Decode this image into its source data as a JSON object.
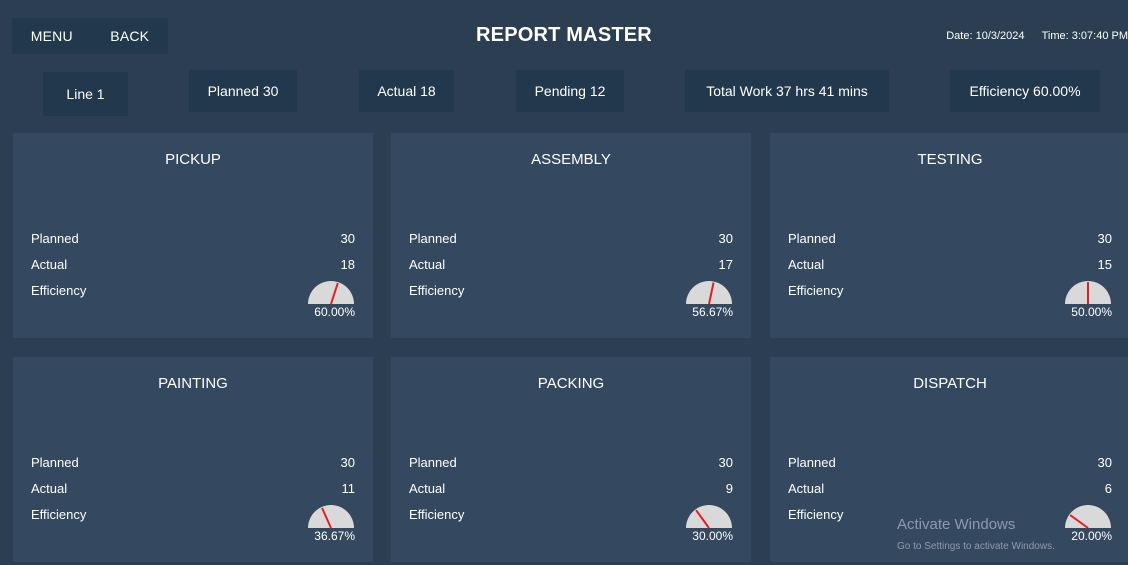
{
  "nav": {
    "menu_label": "MENU",
    "back_label": "BACK"
  },
  "header": {
    "title": "REPORT MASTER",
    "date": "Date: 10/3/2024",
    "time": "Time: 3:07:40 PM"
  },
  "summary": {
    "line": "Line 1",
    "planned": "Planned 30",
    "actual": "Actual 18",
    "pending": "Pending 12",
    "total_work": "Total Work 37 hrs 41 mins",
    "efficiency": "Efficiency 60.00%"
  },
  "labels": {
    "planned": "Planned",
    "actual": "Actual",
    "efficiency": "Efficiency"
  },
  "stations": [
    {
      "name": "PICKUP",
      "planned": "30",
      "actual": "18",
      "efficiency": "60.00%",
      "efficiency_value": 60.0
    },
    {
      "name": "ASSEMBLY",
      "planned": "30",
      "actual": "17",
      "efficiency": "56.67%",
      "efficiency_value": 56.67
    },
    {
      "name": "TESTING",
      "planned": "30",
      "actual": "15",
      "efficiency": "50.00%",
      "efficiency_value": 50.0
    },
    {
      "name": "PAINTING",
      "planned": "30",
      "actual": "11",
      "efficiency": "36.67%",
      "efficiency_value": 36.67
    },
    {
      "name": "PACKING",
      "planned": "30",
      "actual": "9",
      "efficiency": "30.00%",
      "efficiency_value": 30.0
    },
    {
      "name": "DISPATCH",
      "planned": "30",
      "actual": "6",
      "efficiency": "20.00%",
      "efficiency_value": 20.0
    }
  ],
  "watermark": {
    "line1": "Activate Windows",
    "line2": "Go to Settings to activate Windows."
  },
  "colors": {
    "background": "#2c3e51",
    "card": "#34495f",
    "chip": "#22384d",
    "gauge_face": "#d9d9d9",
    "gauge_needle": "#e02020"
  }
}
